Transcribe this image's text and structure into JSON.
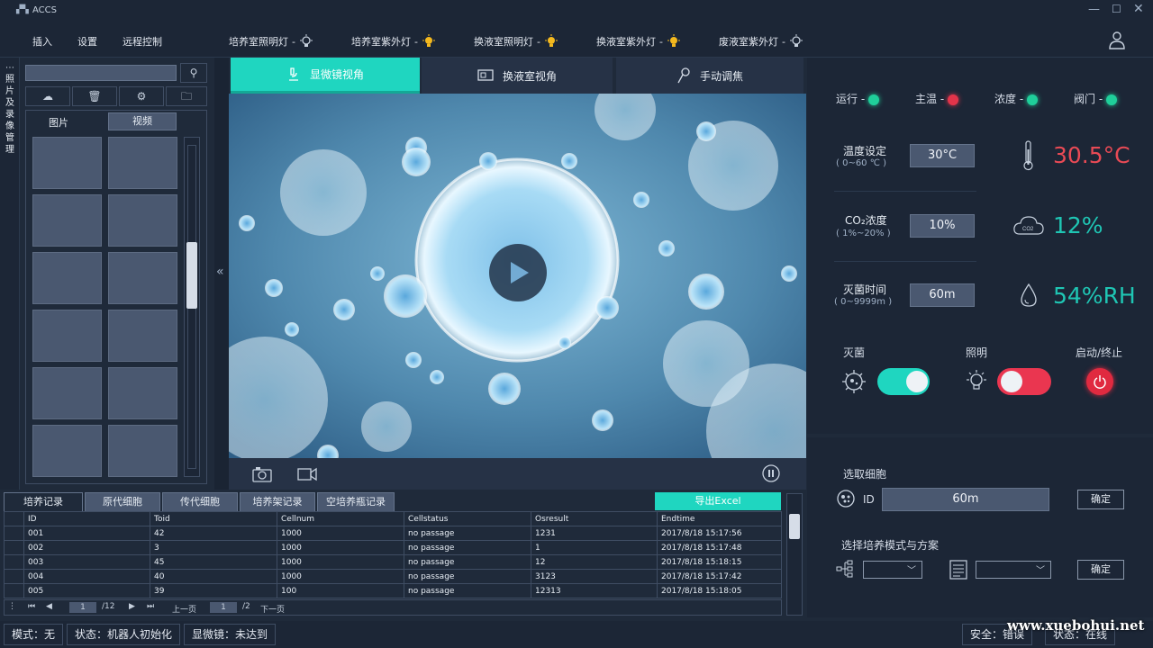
{
  "app": {
    "title": "ACCS"
  },
  "menu": [
    "插入",
    "设置",
    "远程控制"
  ],
  "lamps": [
    {
      "label": "培养室照明灯",
      "state": "off"
    },
    {
      "label": "培养室紫外灯",
      "state": "on"
    },
    {
      "label": "换液室照明灯",
      "state": "on"
    },
    {
      "label": "换液室紫外灯",
      "state": "on"
    },
    {
      "label": "废液室紫外灯",
      "state": "off"
    }
  ],
  "lamp_sep": "-",
  "left": {
    "vertical_label": [
      "照",
      "片",
      "及",
      "录",
      "像",
      "管",
      "理"
    ],
    "search_placeholder": "",
    "tabs": {
      "photos": "图片",
      "videos": "视频"
    }
  },
  "view_tabs": {
    "microscope": "显微镜视角",
    "exchange": "换液室视角",
    "focus": "手动调焦"
  },
  "status_indicators": [
    {
      "label": "运行",
      "color": "#1fcf9a"
    },
    {
      "label": "主温",
      "color": "#e3344a"
    },
    {
      "label": "浓度",
      "color": "#1fcf9a"
    },
    {
      "label": "阀门",
      "color": "#1fcf9a"
    }
  ],
  "settings": {
    "temp": {
      "label": "温度设定",
      "range": "( 0~60 ℃ )",
      "value": "30°C",
      "reading": "30.5°C"
    },
    "co2": {
      "label": "CO₂浓度",
      "range": "( 1%~20% )",
      "value": "10%",
      "reading": "12%",
      "icon_text": "CO2"
    },
    "steril": {
      "label": "灭菌时间",
      "range": "( 0~9999m )",
      "value": "60m",
      "reading": "54%RH"
    }
  },
  "toggles": {
    "steril_label": "灭菌",
    "light_label": "照明",
    "power_label": "启动/终止"
  },
  "cell_select": {
    "title": "选取细胞",
    "id_label": "ID",
    "id_value": "60m",
    "confirm": "确定"
  },
  "culture_mode": {
    "title": "选择培养模式与方案",
    "confirm": "确定"
  },
  "table": {
    "tabs": [
      "培养记录",
      "原代细胞",
      "传代细胞",
      "培养架记录",
      "空培养瓶记录"
    ],
    "export": "导出Excel",
    "headers": [
      "ID",
      "Toid",
      "Cellnum",
      "Cellstatus",
      "Osresult",
      "Endtime"
    ],
    "rows": [
      [
        "001",
        "42",
        "1000",
        "no passage",
        "1231",
        "2017/8/18 15:17:56"
      ],
      [
        "002",
        "3",
        "1000",
        "no passage",
        "1",
        "2017/8/18 15:17:48"
      ],
      [
        "003",
        "45",
        "1000",
        "no passage",
        "12",
        "2017/8/18 15:18:15"
      ],
      [
        "004",
        "40",
        "1000",
        "no passage",
        "3123",
        "2017/8/18 15:17:42"
      ],
      [
        "005",
        "39",
        "100",
        "no passage",
        "12313",
        "2017/8/18 15:18:05"
      ]
    ],
    "pager": {
      "page": "1",
      "total": "/12",
      "prev": "上一页",
      "page2": "1",
      "total2": "/2",
      "next": "下一页"
    }
  },
  "statusbar": {
    "mode": "模式：无",
    "state": "状态：机器人初始化",
    "scope": "显微镜：未达到",
    "safety": "安全：错误",
    "online": "状态：在线"
  },
  "watermark": "www.xuebohui.net",
  "colors": {
    "accent": "#1fd6c0",
    "danger": "#e3344a",
    "teal_text": "#1fc6b4",
    "red_text": "#e84a55"
  }
}
